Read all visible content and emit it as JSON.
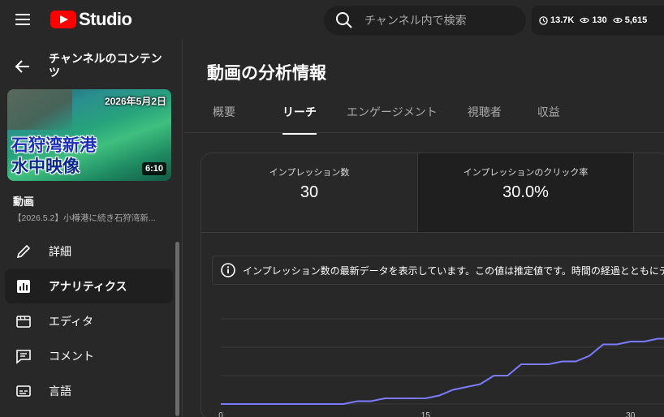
{
  "header": {
    "logo_text": "Studio",
    "search_placeholder": "チャンネル内で検索",
    "stats": [
      {
        "icon": "clock-icon",
        "value": "13.7K"
      },
      {
        "icon": "eye-icon",
        "value": "130"
      },
      {
        "icon": "eye-icon",
        "value": "5,615"
      }
    ]
  },
  "sidebar": {
    "channel_title": "チャンネルのコンテンツ",
    "thumbnail": {
      "date": "2026年5月2日",
      "title_line1": "石狩湾新港",
      "title_line2": "水中映像",
      "duration": "6:10"
    },
    "video_label": "動画",
    "video_desc": "【2026.5.2】小樽港に続き石狩湾新...",
    "nav": [
      {
        "icon": "pencil-icon",
        "label": "詳細",
        "active": false
      },
      {
        "icon": "analytics-icon",
        "label": "アナリティクス",
        "active": true
      },
      {
        "icon": "editor-icon",
        "label": "エディタ",
        "active": false
      },
      {
        "icon": "comment-icon",
        "label": "コメント",
        "active": false
      },
      {
        "icon": "subtitles-icon",
        "label": "言語",
        "active": false
      }
    ]
  },
  "main": {
    "title": "動画の分析情報",
    "tabs": [
      {
        "label": "概要",
        "active": false
      },
      {
        "label": "リーチ",
        "active": true
      },
      {
        "label": "エンゲージメント",
        "active": false
      },
      {
        "label": "視聴者",
        "active": false
      },
      {
        "label": "収益",
        "active": false
      }
    ],
    "metrics": [
      {
        "label": "インプレッション数",
        "value": "30"
      },
      {
        "label": "インプレッションのクリック率",
        "value": "30.0%"
      }
    ],
    "notice": "インプレッション数の最新データを表示しています。この値は推定値です。時間の経過とともにデー"
  },
  "colors": {
    "accent": "#ff0000",
    "line": "#7b7bff",
    "background": "#282828"
  },
  "chart_data": {
    "type": "line",
    "x_ticks": [
      "0",
      "15",
      "30"
    ],
    "xlim": [
      0,
      34
    ],
    "ylim": [
      0,
      30
    ],
    "series": [
      {
        "x": [
          0,
          9,
          10,
          11,
          12,
          13,
          14,
          15,
          16,
          17,
          18,
          19,
          20,
          21,
          22,
          23,
          24,
          25,
          26,
          27,
          28,
          29,
          30,
          31,
          32,
          33,
          34
        ],
        "values": [
          0,
          0,
          1,
          1,
          2,
          2,
          2,
          2,
          3,
          5,
          6,
          7,
          10,
          10,
          14,
          14,
          14,
          15,
          15,
          17,
          21,
          21,
          22,
          22,
          23,
          23,
          23
        ]
      }
    ]
  }
}
